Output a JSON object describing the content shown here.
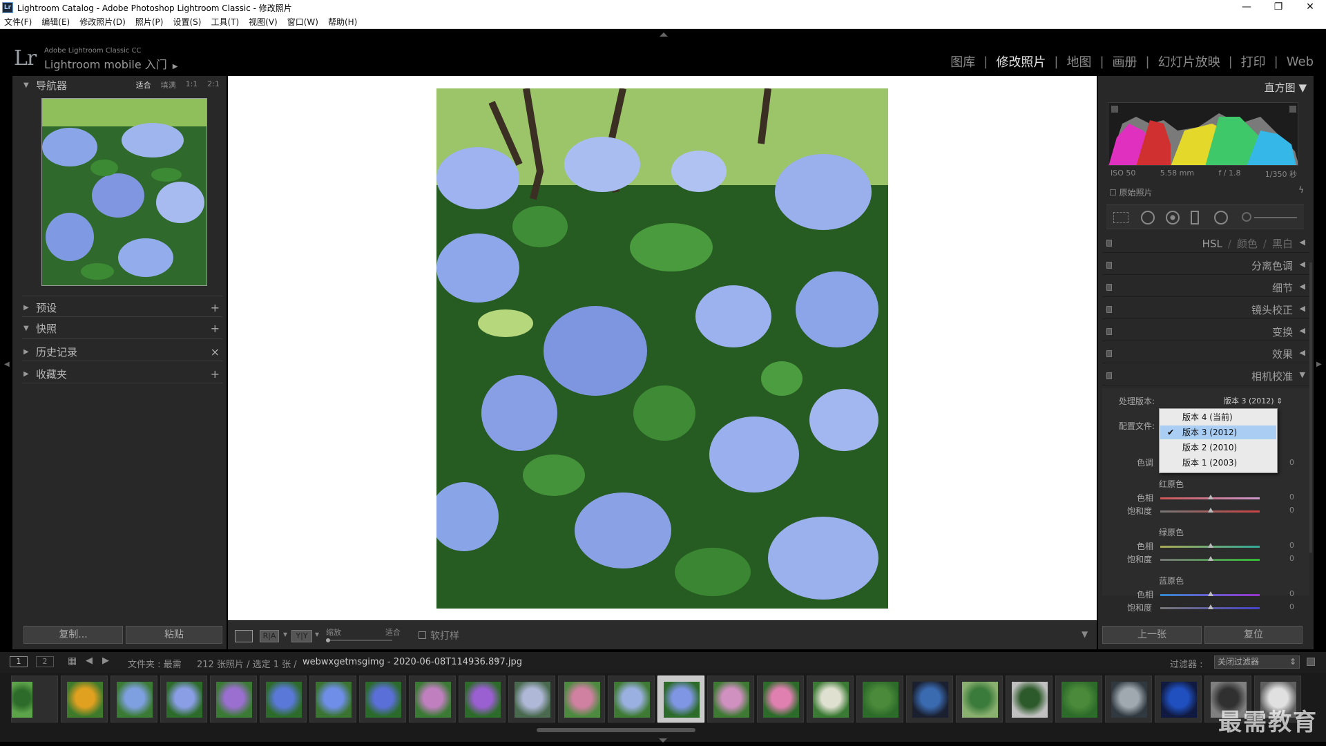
{
  "window": {
    "title": "Lightroom Catalog - Adobe Photoshop Lightroom Classic - 修改照片",
    "icon_text": "Lr",
    "controls": [
      "—",
      "❐",
      "✕"
    ]
  },
  "menu": [
    "文件(F)",
    "编辑(E)",
    "修改照片(D)",
    "照片(P)",
    "设置(S)",
    "工具(T)",
    "视图(V)",
    "窗口(W)",
    "帮助(H)"
  ],
  "identity": {
    "logo": "Lr",
    "line1": "Adobe Lightroom Classic CC",
    "line2": "Lightroom mobile 入门"
  },
  "modules": [
    "图库",
    "修改照片",
    "地图",
    "画册",
    "幻灯片放映",
    "打印",
    "Web"
  ],
  "active_module": "修改照片",
  "left_panel": {
    "navigator": {
      "title": "导航器",
      "zoom": [
        "适合",
        "填满",
        "1:1",
        "2:1"
      ]
    },
    "sections": [
      {
        "title": "预设",
        "action": "+"
      },
      {
        "title": "快照",
        "action": "+"
      },
      {
        "title": "历史记录",
        "action": "×"
      },
      {
        "title": "收藏夹",
        "action": "+"
      }
    ],
    "buttons": {
      "copy": "复制...",
      "paste": "粘贴"
    }
  },
  "toolbar": {
    "zoom_label": "缩放",
    "fit_label": "适合",
    "softproof_label": "软打样",
    "ra": "R|A",
    "yy": "Y|Y"
  },
  "right_panel": {
    "histogram_title": "直方图",
    "exif": [
      "ISO 50",
      "5.58 mm",
      "f / 1.8",
      "1/350 秒"
    ],
    "original_photo": "原始照片",
    "hsl": {
      "a": "HSL",
      "b": "颜色",
      "c": "黑白"
    },
    "sections": [
      "分离色调",
      "细节",
      "镜头校正",
      "变换",
      "效果",
      "相机校准"
    ],
    "calibration": {
      "process_label": "处理版本:",
      "process_value": "版本 3 (2012)",
      "profile_label": "配置文件:",
      "tint_label": "色调",
      "tint_value": "0",
      "groups": [
        {
          "title": "红原色",
          "hue": "色相",
          "sat": "饱和度",
          "hue_val": "0",
          "sat_val": "0"
        },
        {
          "title": "绿原色",
          "hue": "色相",
          "sat": "饱和度",
          "hue_val": "0",
          "sat_val": "0"
        },
        {
          "title": "蓝原色",
          "hue": "色相",
          "sat": "饱和度",
          "hue_val": "0",
          "sat_val": "0"
        }
      ]
    },
    "dropdown_options": [
      "版本 4 (当前)",
      "版本 3 (2012)",
      "版本 2 (2010)",
      "版本 1 (2003)"
    ],
    "dropdown_selected": "版本 3 (2012)",
    "buttons": {
      "prev": "上一张",
      "reset": "复位"
    }
  },
  "filmstrip": {
    "pages": [
      "1",
      "2"
    ],
    "source_prefix": "文件夹 : 最需",
    "count": "212 张照片 / 选定 1 张 /",
    "filename": "webwxgetmsgimg - 2020-06-08T114936.897.jpg",
    "filter_label": "过滤器 :",
    "filter_value": "关闭过滤器",
    "thumbnail_count": 26,
    "selected_index": 13
  },
  "watermark": "最需教育",
  "colors": {
    "panel": "#282828",
    "accent_select": "#a9cdf3",
    "hydrangea": "#8aa6e8",
    "leaf": "#2e6b2a"
  }
}
